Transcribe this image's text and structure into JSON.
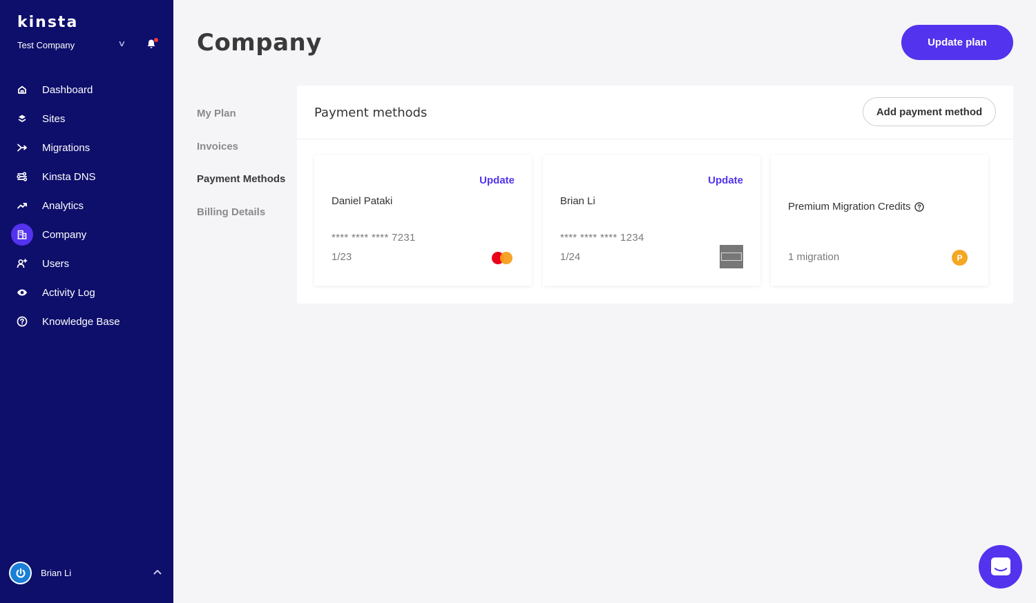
{
  "brand": {
    "logo": "kinsta",
    "accent": "#5333ed",
    "sidebar_bg": "#0e0e6b"
  },
  "sidebar": {
    "company_name": "Test Company",
    "items": [
      {
        "label": "Dashboard",
        "icon": "home-icon"
      },
      {
        "label": "Sites",
        "icon": "layers-icon"
      },
      {
        "label": "Migrations",
        "icon": "migrations-icon"
      },
      {
        "label": "Kinsta DNS",
        "icon": "dns-icon"
      },
      {
        "label": "Analytics",
        "icon": "analytics-icon"
      },
      {
        "label": "Company",
        "icon": "building-icon",
        "active": true
      },
      {
        "label": "Users",
        "icon": "add-user-icon"
      },
      {
        "label": "Activity Log",
        "icon": "eye-icon"
      },
      {
        "label": "Knowledge Base",
        "icon": "help-circle-icon"
      }
    ],
    "user": {
      "name": "Brian Li"
    }
  },
  "header": {
    "title": "Company",
    "update_plan_label": "Update plan"
  },
  "subnav": {
    "items": [
      {
        "label": "My Plan"
      },
      {
        "label": "Invoices"
      },
      {
        "label": "Payment Methods",
        "active": true
      },
      {
        "label": "Billing Details"
      }
    ]
  },
  "payment": {
    "title": "Payment methods",
    "add_label": "Add payment method",
    "cards": [
      {
        "update_label": "Update",
        "holder": "Daniel Pataki",
        "number": "**** **** **** 7231",
        "expiry": "1/23",
        "brand": "mastercard-icon"
      },
      {
        "update_label": "Update",
        "holder": "Brian Li",
        "number": "**** **** **** 1234",
        "expiry": "1/24",
        "brand": "amex-icon"
      }
    ],
    "credits": {
      "title": "Premium Migration Credits",
      "count": "1 migration",
      "badge": "P"
    }
  }
}
